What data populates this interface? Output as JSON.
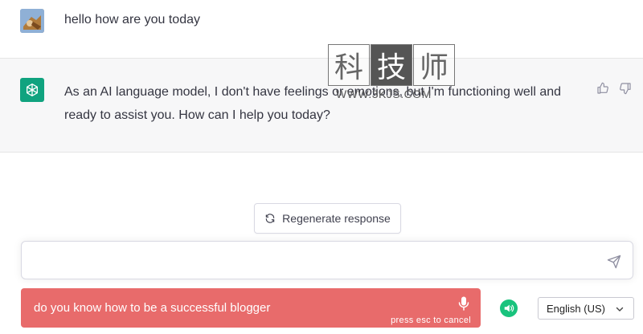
{
  "user_message": {
    "text": "hello how are you today",
    "avatar_icon": "user-avatar-photo"
  },
  "assistant_message": {
    "text": "As an AI language model, I don't have feelings or emotions, but I'm functioning well and ready to assist you. How can I help you today?",
    "avatar_icon": "openai-logo-icon",
    "avatar_color": "#10a37f",
    "feedback_icons": [
      "thumbs-up-icon",
      "thumbs-down-icon"
    ]
  },
  "watermark": {
    "chars": [
      "科",
      "技",
      "师"
    ],
    "url": "WWW.3KJS.COM"
  },
  "regenerate": {
    "label": "Regenerate response",
    "icon": "refresh-icon"
  },
  "composer": {
    "value": "",
    "placeholder": "",
    "send_icon": "send-icon"
  },
  "voice_input": {
    "transcript": "do you know how to be a successful blogger",
    "hint": "press esc to cancel",
    "icon": "microphone-icon",
    "color": "#e86b6b"
  },
  "speaker": {
    "icon": "speaker-icon",
    "color": "#19c37d"
  },
  "language_select": {
    "selected": "English (US)",
    "icon": "chevron-down-icon"
  }
}
